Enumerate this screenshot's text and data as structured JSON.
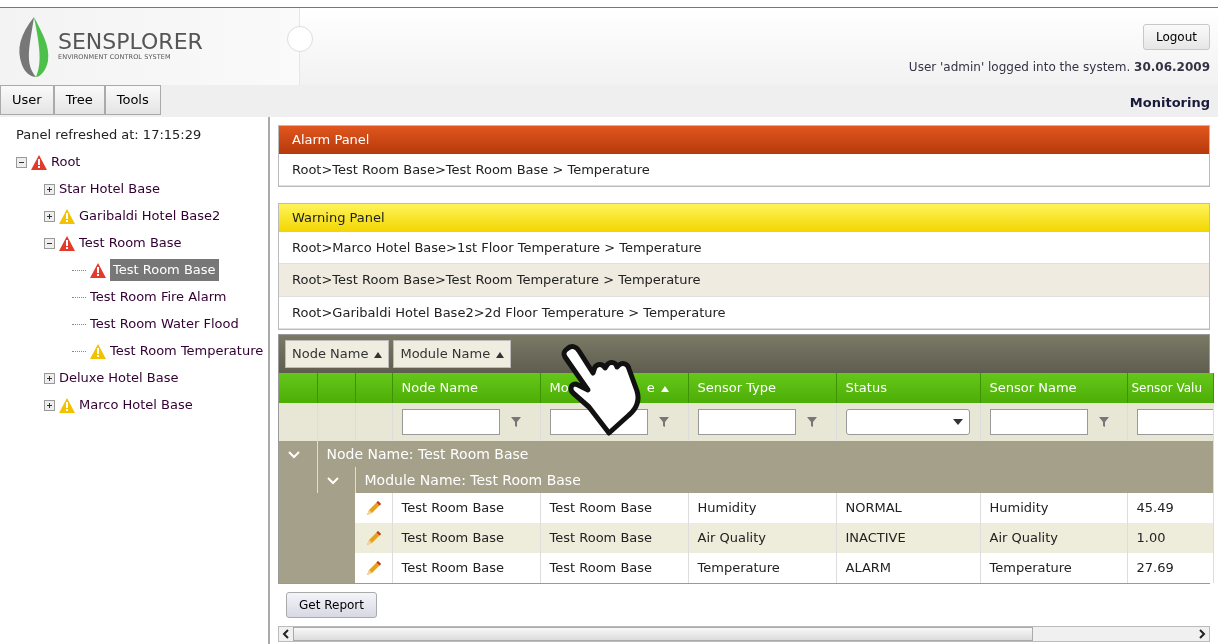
{
  "header": {
    "brand": "SENSPLORER",
    "tagline": "ENVIRONMENT CONTROL SYSTEM",
    "logout": "Logout",
    "login_text": "User 'admin' logged into the system.",
    "date": "30.06.2009"
  },
  "menu": [
    {
      "label": "User"
    },
    {
      "label": "Tree"
    },
    {
      "label": "Tools"
    }
  ],
  "section_title": "Monitoring",
  "sidebar": {
    "refreshed": "Panel refreshed at: 17:15:29",
    "tree": [
      {
        "label": "Root",
        "kind": "alarm",
        "expanded": true,
        "selected": false,
        "children": [
          {
            "label": "Star Hotel Base",
            "kind": "plain",
            "expanded": false,
            "selected": false
          },
          {
            "label": "Garibaldi Hotel Base2",
            "kind": "warning",
            "expanded": false,
            "selected": false
          },
          {
            "label": "Test Room Base",
            "kind": "alarm",
            "expanded": true,
            "selected": false,
            "children": [
              {
                "label": "Test Room Base",
                "kind": "alarm",
                "selected": true
              },
              {
                "label": "Test Room Fire Alarm",
                "kind": "plain",
                "selected": false
              },
              {
                "label": "Test Room Water Flood",
                "kind": "plain",
                "selected": false
              },
              {
                "label": "Test Room Temperature",
                "kind": "warning",
                "selected": false
              }
            ]
          },
          {
            "label": "Deluxe Hotel Base",
            "kind": "plain",
            "expanded": false,
            "selected": false
          },
          {
            "label": "Marco Hotel Base",
            "kind": "warning",
            "expanded": false,
            "selected": false
          }
        ]
      }
    ]
  },
  "alarm_panel": {
    "title": "Alarm Panel",
    "items": [
      {
        "text": "Root>Test Room Base>Test Room Base > Temperature",
        "selected": false
      }
    ]
  },
  "warning_panel": {
    "title": "Warning Panel",
    "items": [
      {
        "text": "Root>Marco Hotel Base>1st Floor Temperature > Temperature",
        "selected": false
      },
      {
        "text": "Root>Test Room Base>Test Room Temperature > Temperature",
        "selected": true
      },
      {
        "text": "Root>Garibaldi Hotel Base2>2d Floor Temperature > Temperature",
        "selected": false
      }
    ]
  },
  "grid": {
    "group_chips": [
      {
        "label": "Node Name"
      },
      {
        "label": "Module Name"
      }
    ],
    "columns": [
      {
        "label": "Node Name",
        "kind": "text",
        "sorted": false
      },
      {
        "label": "Mo",
        "label_tail": "e",
        "kind": "text",
        "sorted": true
      },
      {
        "label": "Sensor Type",
        "kind": "text",
        "sorted": false
      },
      {
        "label": "Status",
        "kind": "dropdown",
        "sorted": false
      },
      {
        "label": "Sensor Name",
        "kind": "text",
        "sorted": false
      },
      {
        "label": "Sensor Valu",
        "kind": "cut",
        "sorted": false
      }
    ],
    "groups": [
      {
        "label": "Node Name: Test Room Base",
        "expanded": true,
        "subgroups": [
          {
            "label": "Module Name: Test Room Base",
            "expanded": true,
            "rows": [
              [
                "Test Room Base",
                "Test Room Base",
                "Humidity",
                "NORMAL",
                "Humidity",
                "45.49"
              ],
              [
                "Test Room Base",
                "Test Room Base",
                "Air Quality",
                "INACTIVE",
                "Air Quality",
                "1.00"
              ],
              [
                "Test Room Base",
                "Test Room Base",
                "Temperature",
                "ALARM",
                "Temperature",
                "27.69"
              ]
            ]
          }
        ]
      }
    ]
  },
  "report_button": "Get Report"
}
